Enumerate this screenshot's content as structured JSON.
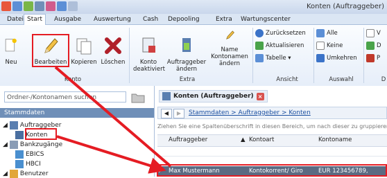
{
  "window": {
    "title": "Konten (Auftraggeber)"
  },
  "colors": {
    "accent": "#6f8fb8",
    "highlight": "#e51c23",
    "selected_row": "#5b6b82"
  },
  "tabs": [
    "Datei",
    "Start",
    "Ausgabe",
    "Auswertung",
    "Cash",
    "Depooling",
    "Extra",
    "Wartungscenter"
  ],
  "ribbon": {
    "buttons": {
      "neu": "Neu",
      "bearbeiten": "Bearbeiten",
      "kopieren": "Kopieren",
      "loeschen": "Löschen",
      "konto_deaktiviert": "Konto\ndeaktiviert",
      "auftraggeber_aendern": "Auftraggeber\nändern",
      "kontonamen_aendern": "Kontonamen\nändern",
      "name": "Name"
    },
    "small": {
      "zuruecksetzen": "Zurücksetzen",
      "aktualisieren": "Aktualisieren",
      "tabelle": "Tabelle ▾",
      "alle": "Alle",
      "keine": "Keine",
      "umkehren": "Umkehren",
      "cut_v": "V",
      "cut_d": "D",
      "cut_p": "P"
    },
    "groups": {
      "konto": "Konto",
      "extra": "Extra",
      "ansicht": "Ansicht",
      "auswahl": "Auswahl",
      "cut_d": "D"
    }
  },
  "left": {
    "search_placeholder": "Ordner-/Kontonamen suchen",
    "section": "Stammdaten",
    "tree": {
      "auftraggeber": "Auftraggeber",
      "konten": "Konten",
      "bankzugaenge": "Bankzugänge",
      "ebics": "EBICS",
      "hbci": "HBCI",
      "benutzer": "Benutzer"
    }
  },
  "main": {
    "tab_title": "Konten (Auftraggeber)",
    "breadcrumb": "Stammdaten > Auftraggeber > Konten",
    "group_hint": "Ziehen Sie eine Spaltenüberschrift in diesen Bereich, um nach dieser zu gruppieren",
    "columns": [
      "Auftraggeber",
      "Kontoart",
      "Kontoname"
    ],
    "row": {
      "auftraggeber": "Max Mustermann",
      "kontoart": "Kontokorrent/ Giro",
      "kontoname": "EUR 123456789,"
    }
  }
}
